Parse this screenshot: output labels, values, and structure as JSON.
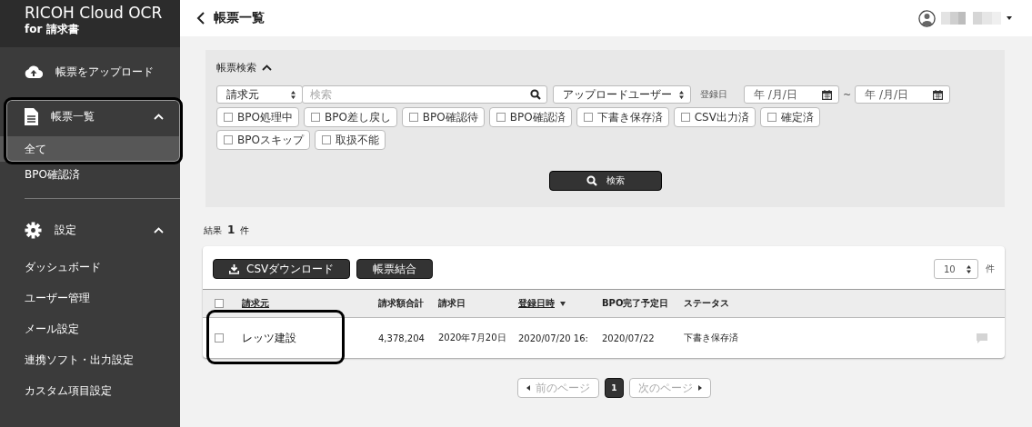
{
  "sidebar": {
    "brand": "RICOH Cloud OCR",
    "brand_sub": "for 請求書",
    "items": [
      {
        "label": "帳票をアップロード",
        "highlighted": false
      },
      {
        "label": "帳票一覧",
        "expanded": true,
        "highlighted": true,
        "children": [
          {
            "label": "全て",
            "selected": true
          },
          {
            "label": "BPO確認済",
            "selected": false
          }
        ]
      },
      {
        "label": "設定",
        "expanded": true,
        "highlighted": false,
        "children": [
          {
            "label": "ダッシュボード",
            "selected": false
          },
          {
            "label": "ユーザー管理",
            "selected": false
          },
          {
            "label": "メール設定",
            "selected": false
          },
          {
            "label": "連携ソフト・出力設定",
            "selected": false
          },
          {
            "label": "カスタム項目設定",
            "selected": false
          }
        ]
      }
    ]
  },
  "header": {
    "title": "帳票一覧"
  },
  "search": {
    "title": "帳票検索",
    "expanded": true,
    "field_select": "請求元",
    "query": {
      "placeholder": "検索"
    },
    "user_select": "アップロードユーザー",
    "date_label": "登録日",
    "date_from": {
      "placeholder": "年 /月/日"
    },
    "range_sep": "~",
    "date_to": {
      "placeholder": "年 /月/日"
    },
    "filters": [
      {
        "label": "BPO処理中",
        "checked": false
      },
      {
        "label": "BPO差し戻し",
        "checked": false
      },
      {
        "label": "BPO確認待",
        "checked": false
      },
      {
        "label": "BPO確認済",
        "checked": false
      },
      {
        "label": "下書き保存済",
        "checked": false
      },
      {
        "label": "CSV出力済",
        "checked": false
      },
      {
        "label": "確定済",
        "checked": false
      },
      {
        "label": "BPOスキップ",
        "checked": false
      },
      {
        "label": "取扱不能",
        "checked": false
      }
    ],
    "button": "検索"
  },
  "results": {
    "label": "結果",
    "count": "1",
    "unit": "件"
  },
  "table": {
    "buttons": [
      {
        "label": "CSVダウンロード"
      },
      {
        "label": "帳票結合"
      }
    ],
    "page_size": "10",
    "page_size_unit": "件",
    "all_checked": false,
    "columns": [
      {
        "label": "請求元",
        "sortable": true,
        "sort_descending": false
      },
      {
        "label": "請求額合計",
        "sortable": false,
        "sort_descending": false
      },
      {
        "label": "請求日",
        "sortable": false,
        "sort_descending": false
      },
      {
        "label": "登録日時",
        "sortable": true,
        "sort_descending": true
      },
      {
        "label": "BPO完了予定日",
        "sortable": false,
        "sort_descending": false
      },
      {
        "label": "ステータス",
        "sortable": false,
        "sort_descending": false
      }
    ],
    "rows": [
      {
        "checked": false,
        "highlighted": true,
        "cells": [
          "レッツ建設",
          "4,378,204",
          "2020年7月20日",
          "2020/07/20 16:",
          "2020/07/22",
          "下書き保存済"
        ]
      }
    ]
  },
  "pagination": {
    "prev": {
      "label": "前のページ",
      "disabled": true
    },
    "pages": [
      {
        "label": "1",
        "selected": true
      }
    ],
    "next": {
      "label": "次のページ",
      "disabled": true
    }
  }
}
